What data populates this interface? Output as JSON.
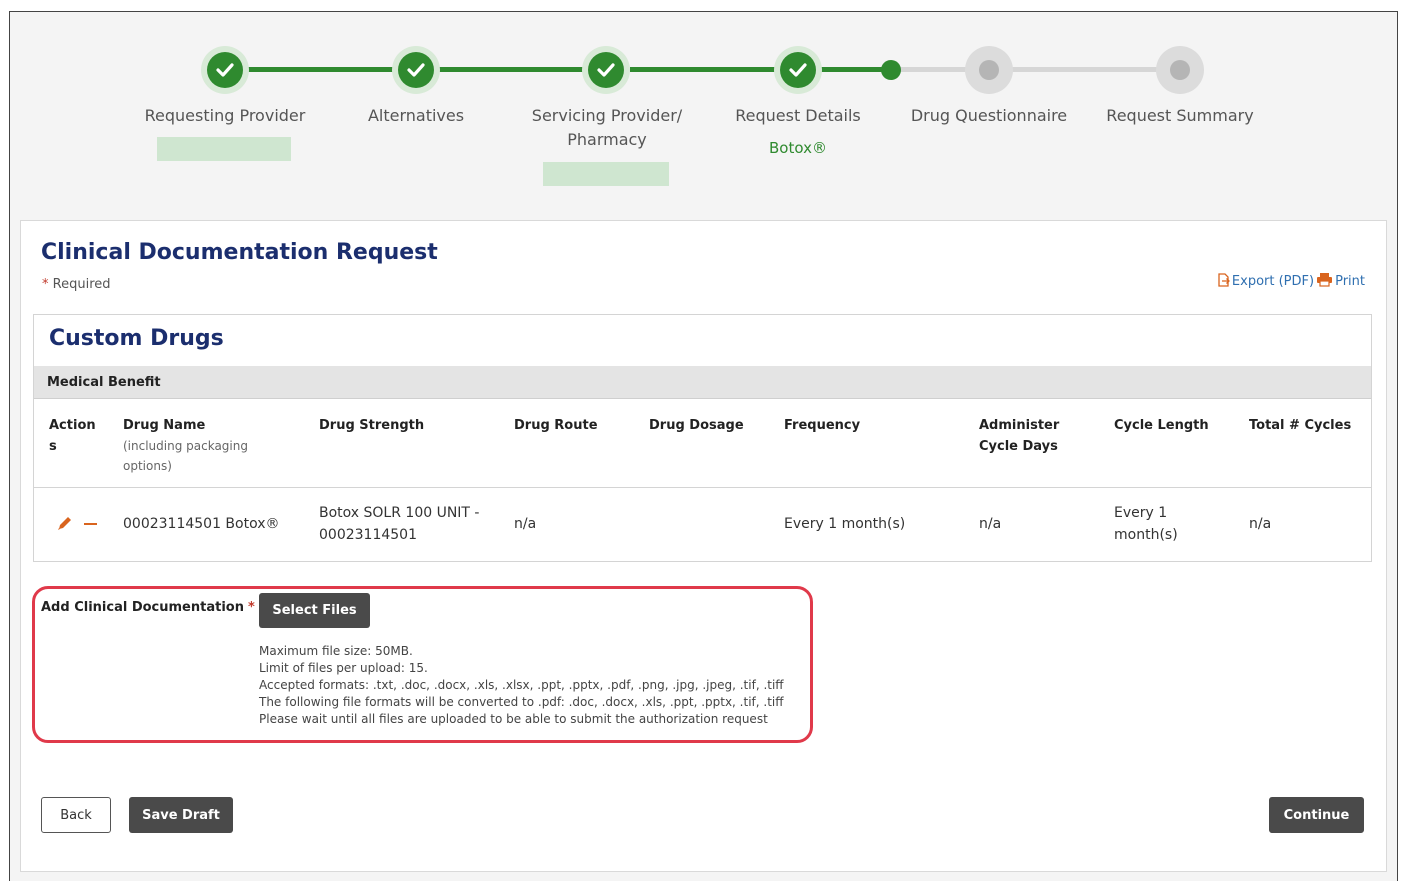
{
  "stepper": {
    "steps": [
      {
        "label": "Requesting Provider",
        "status": "complete"
      },
      {
        "label": "Alternatives",
        "status": "complete"
      },
      {
        "label": "Servicing Provider/",
        "label2": "Pharmacy",
        "status": "complete"
      },
      {
        "label": "Request Details",
        "status": "complete",
        "sub": "Botox®"
      },
      {
        "label": "Drug Questionnaire",
        "status": "pending"
      },
      {
        "label": "Request Summary",
        "status": "pending"
      }
    ]
  },
  "header": {
    "title": "Clinical Documentation Request",
    "required_star": "*",
    "required_text": "Required",
    "export_label": "Export (PDF)",
    "print_label": "Print"
  },
  "drugs": {
    "title": "Custom Drugs",
    "benefit": "Medical Benefit",
    "columns": [
      {
        "label": "Action",
        "label2": "s"
      },
      {
        "label": "Drug Name",
        "sub": "(including packaging",
        "sub2": "options)"
      },
      {
        "label": "Drug Strength"
      },
      {
        "label": "Drug Route"
      },
      {
        "label": "Drug Dosage"
      },
      {
        "label": "Frequency"
      },
      {
        "label": "Administer",
        "label2": "Cycle Days"
      },
      {
        "label": "Cycle Length"
      },
      {
        "label": "Total # Cycles"
      }
    ],
    "rows": [
      {
        "drug_name": "00023114501 Botox®",
        "strength_1": "Botox SOLR 100 UNIT -",
        "strength_2": "00023114501",
        "route": "n/a",
        "dosage": "",
        "frequency": "Every 1 month(s)",
        "cycle_days": "n/a",
        "cycle_length_1": "Every 1",
        "cycle_length_2": "month(s)",
        "total_cycles": "n/a"
      }
    ]
  },
  "documentation": {
    "label": "Add Clinical Documentation",
    "star": "*",
    "select_files": "Select Files",
    "notes": [
      "Maximum file size: 50MB.",
      "Limit of files per upload: 15.",
      "Accepted formats: .txt, .doc, .docx, .xls, .xlsx, .ppt, .pptx, .pdf, .png, .jpg, .jpeg, .tif, .tiff",
      "The following file formats will be converted to .pdf: .doc, .docx, .xls, .ppt, .pptx, .tif, .tiff",
      "Please wait until all files are uploaded to be able to submit the authorization request"
    ]
  },
  "footer": {
    "back": "Back",
    "save_draft": "Save Draft",
    "continue": "Continue"
  },
  "colors": {
    "accent_green": "#2f8a2f",
    "title_navy": "#1b2e6e",
    "link_blue": "#2f6fb0",
    "highlight_red": "#e0394a",
    "edit_orange": "#d9641e"
  },
  "icons": [
    "check-icon",
    "export-pdf-icon",
    "print-icon",
    "edit-pencil-icon",
    "remove-minus-icon"
  ]
}
